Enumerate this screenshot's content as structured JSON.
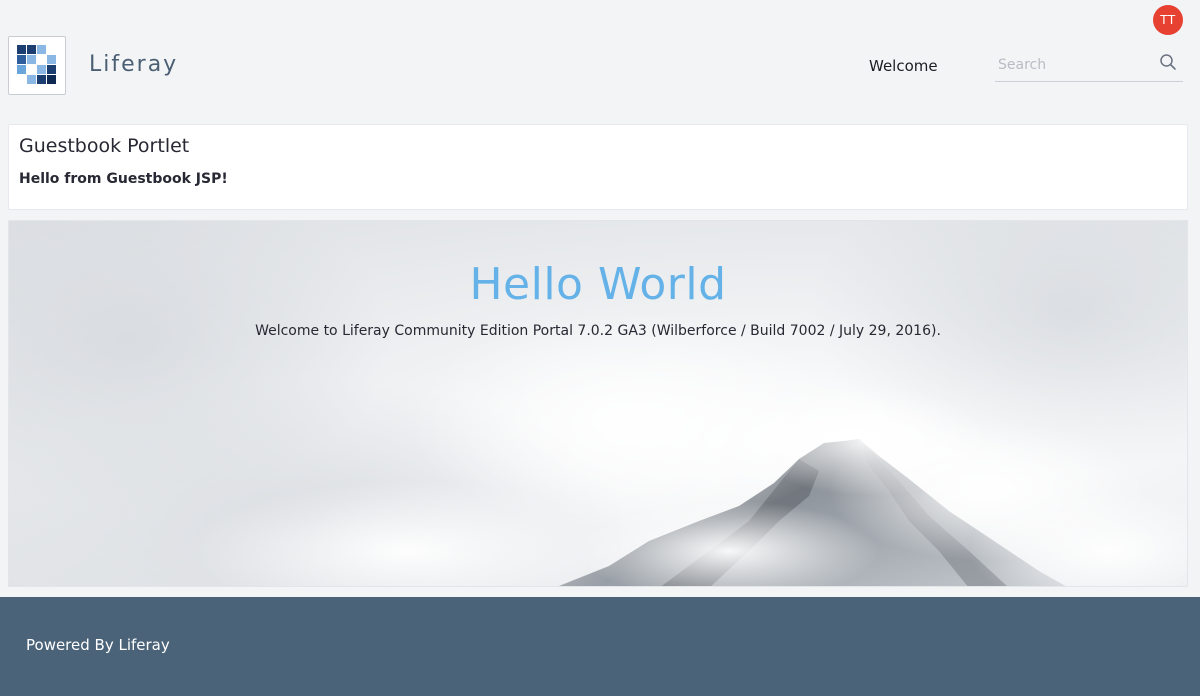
{
  "user": {
    "avatar_initials": "TT",
    "avatar_color": "#e64131"
  },
  "header": {
    "site_name": "Liferay",
    "nav_items": [
      "Welcome"
    ],
    "search": {
      "placeholder": "Search",
      "value": ""
    }
  },
  "portlet": {
    "title": "Guestbook Portlet",
    "body": "Hello from Guestbook JSP!"
  },
  "hero": {
    "title": "Hello World",
    "subtitle": "Welcome to Liferay Community Edition Portal 7.0.2 GA3 (Wilberforce / Build 7002 / July 29, 2016).",
    "title_color": "#65b2e8"
  },
  "footer": {
    "text": "Powered By Liferay",
    "background": "#4a6378"
  },
  "icons": {
    "logo": "liferay-logo-icon",
    "search": "search-icon"
  }
}
